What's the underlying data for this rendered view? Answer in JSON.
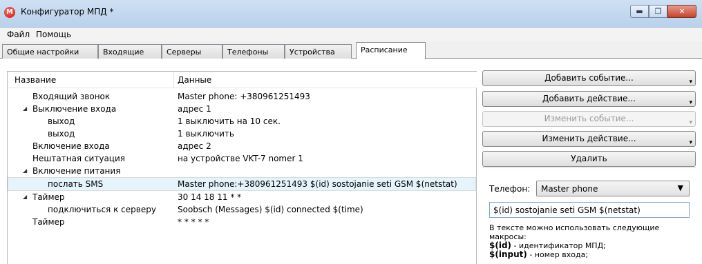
{
  "window": {
    "title": "Конфигуратор МПД *",
    "icon_letter": "M"
  },
  "menu": [
    "Файл",
    "Помощь"
  ],
  "tabs": [
    "Общие настройки",
    "Входящие",
    "Серверы",
    "Телефоны",
    "Устройства",
    "Расписание"
  ],
  "active_tab": "Расписание",
  "tree": {
    "columns": [
      "Название",
      "Данные"
    ],
    "rows": [
      {
        "name": "Входящий звонок",
        "value": "Master phone: +380961251493"
      },
      {
        "name": "Выключение входа",
        "value": "адрес 1"
      },
      {
        "name": "выход",
        "value": "1 выключить на 10 сек."
      },
      {
        "name": "выход",
        "value": "1 выключить"
      },
      {
        "name": "Включение входа",
        "value": "адрес 2"
      },
      {
        "name": "Нештатная ситуация",
        "value": "на устройстве VKT-7 nomer 1"
      },
      {
        "name": "Включение питания",
        "value": ""
      },
      {
        "name": "послать SMS",
        "value": "Master phone:+380961251493 $(id) sostojanie seti GSM $(netstat)"
      },
      {
        "name": "Таймер",
        "value": "30 14 18 11 * *"
      },
      {
        "name": "подключиться к серверу",
        "value": "Soobsch (Messages) $(id) connected $(time)"
      },
      {
        "name": "Таймер",
        "value": "* * * * *"
      }
    ]
  },
  "actions": {
    "add_event": "Добавить событие...",
    "add_action": "Добавить действие...",
    "edit_event": "Изменить событие...",
    "edit_action": "Изменить действие...",
    "delete": "Удалить"
  },
  "sms_editor": {
    "phone_label": "Телефон:",
    "phone_value": "Master phone",
    "message": "$(id) sostojanie seti GSM $(netstat)",
    "hint_intro": "В тексте можно использовать следующие макросы:",
    "macro1_code": "$(id)",
    "macro1_desc": " - идентификатор МПД;",
    "macro2_code": "$(input)",
    "macro2_desc": " - номер входа;"
  }
}
